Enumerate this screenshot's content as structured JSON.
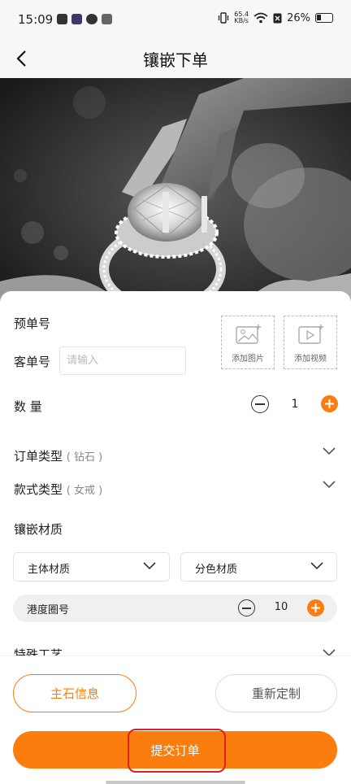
{
  "status": {
    "time": "15:09",
    "net_speed_value": "65.4",
    "net_speed_unit": "KB/s",
    "battery": "26%",
    "icons": [
      "mail-icon",
      "video-app-icon",
      "wechat-icon",
      "more-icon",
      "vibrate-icon",
      "wifi-icon",
      "sim-off-icon",
      "battery-icon"
    ]
  },
  "nav": {
    "back_icon": "chevron-left-icon",
    "title": "镶嵌下单"
  },
  "form": {
    "pre_order_label": "预单号",
    "customer_order_label": "客单号",
    "customer_order_placeholder": "请输入",
    "customer_order_value": "",
    "add_image_label": "添加图片",
    "add_video_label": "添加视频",
    "quantity_label": "数 量",
    "quantity_value": "1",
    "order_type_label": "订单类型",
    "order_type_value": "( 钻石 )",
    "style_type_label": "款式类型",
    "style_type_value": "( 女戒 )",
    "inlay_material_label": "镶嵌材质",
    "main_material_label": "主体材质",
    "split_material_label": "分色材质",
    "ring_size_label": "港度圈号",
    "ring_size_value": "10",
    "special_craft_label": "特殊工艺"
  },
  "actions": {
    "main_stone_label": "主石信息",
    "recustom_label": "重新定制",
    "submit_label": "提交订单"
  },
  "colors": {
    "accent": "#fa7d0e",
    "highlight_frame": "#e02020"
  }
}
